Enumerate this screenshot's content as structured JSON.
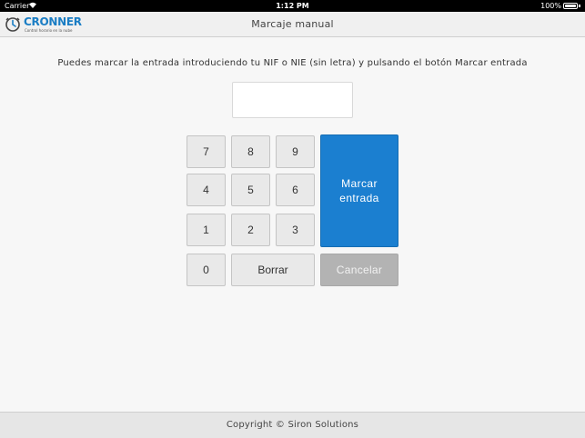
{
  "status_bar": {
    "carrier": "Carrier",
    "time": "1:12 PM",
    "battery": "100%"
  },
  "nav": {
    "logo_text": "CRONNER",
    "logo_tagline": "Control horario en la nube",
    "title": "Marcaje manual"
  },
  "instruction": "Puedes marcar la entrada introduciendo tu NIF o NIE (sin letra) y pulsando el botón Marcar entrada",
  "nif_input": {
    "value": "",
    "placeholder": ""
  },
  "keypad": {
    "k7": "7",
    "k8": "8",
    "k9": "9",
    "k4": "4",
    "k5": "5",
    "k6": "6",
    "k1": "1",
    "k2": "2",
    "k3": "3",
    "k0": "0",
    "delete": "Borrar",
    "submit_line1": "Marcar",
    "submit_line2": "entrada",
    "cancel": "Cancelar"
  },
  "footer": "Copyright © Siron Solutions",
  "colors": {
    "accent": "#1b7fd0",
    "cancel_disabled": "#b3b3b3",
    "brand": "#1a7dc4"
  }
}
